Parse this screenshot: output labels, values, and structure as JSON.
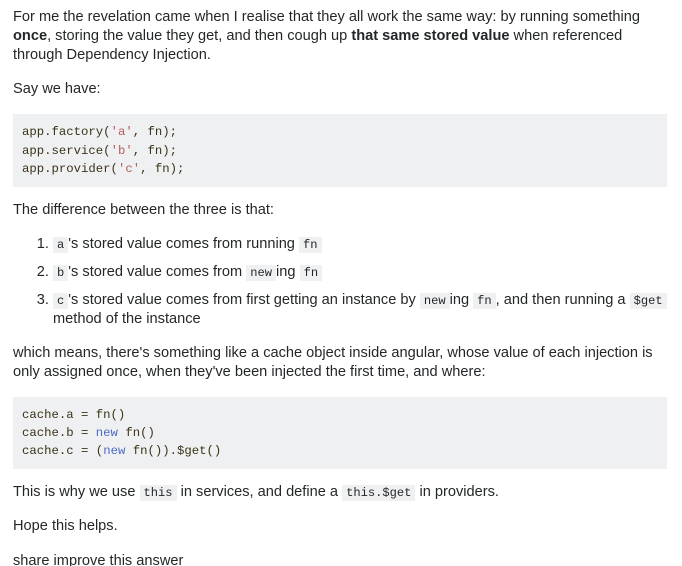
{
  "post": {
    "intro_paragraph": {
      "seg1": "For me the revelation came when I realise that they all work the same way: by running something ",
      "bold1": "once",
      "seg2": ", storing the value they get, and then cough up ",
      "bold2": "that same stored value",
      "seg3": " when referenced through Dependency Injection."
    },
    "say_we_have": "Say we have:",
    "code_block_1": {
      "lines": [
        [
          {
            "t": "app.factory(",
            "k": "plain"
          },
          {
            "t": "'a'",
            "k": "string"
          },
          {
            "t": ", fn);",
            "k": "plain"
          }
        ],
        [
          {
            "t": "app.service(",
            "k": "plain"
          },
          {
            "t": "'b'",
            "k": "string"
          },
          {
            "t": ", fn);",
            "k": "plain"
          }
        ],
        [
          {
            "t": "app.provider(",
            "k": "plain"
          },
          {
            "t": "'c'",
            "k": "string"
          },
          {
            "t": ", fn);",
            "k": "plain"
          }
        ]
      ]
    },
    "difference_lead": "The difference between the three is that:",
    "steps": [
      {
        "code_a": "a",
        "text_a": "'s stored value comes from running ",
        "code_b": "fn",
        "text_b": "",
        "code_c": "",
        "text_c": "",
        "code_d": "",
        "text_d": ""
      },
      {
        "code_a": "b",
        "text_a": "'s stored value comes from ",
        "code_b": "new",
        "text_b": "ing ",
        "code_c": "fn",
        "text_c": "",
        "code_d": "",
        "text_d": ""
      },
      {
        "code_a": "c",
        "text_a": "'s stored value comes from first getting an instance by ",
        "code_b": "new",
        "text_b": "ing ",
        "code_c": "fn",
        "text_c": ", and then running a ",
        "code_d": "$get",
        "text_d": " method of the instance"
      }
    ],
    "which_means_paragraph": "which means, there's something like a cache object inside angular, whose value of each injection is only assigned once, when they've been injected the first time, and where:",
    "code_block_2": {
      "lines": [
        [
          {
            "t": "cache.a = fn()",
            "k": "plain"
          }
        ],
        [
          {
            "t": "cache.b = ",
            "k": "plain"
          },
          {
            "t": "new",
            "k": "keyword"
          },
          {
            "t": " fn()",
            "k": "plain"
          }
        ],
        [
          {
            "t": "cache.c = (",
            "k": "plain"
          },
          {
            "t": "new",
            "k": "keyword"
          },
          {
            "t": " fn()).$get()",
            "k": "plain"
          }
        ]
      ]
    },
    "this_is_why": {
      "seg1": "This is why we use ",
      "code1": "this",
      "seg2": " in services, and define a ",
      "code2": "this.$get",
      "seg3": " in providers."
    },
    "hope_this_helps": "Hope this helps.",
    "clipped_line": "share improve this answer"
  },
  "colors": {
    "text": "#242729",
    "code_background": "#eff0f1",
    "code_text": "#393318",
    "string_token": "#b85c5c",
    "keyword_token": "#4b69c6",
    "page_background": "#ffffff"
  }
}
